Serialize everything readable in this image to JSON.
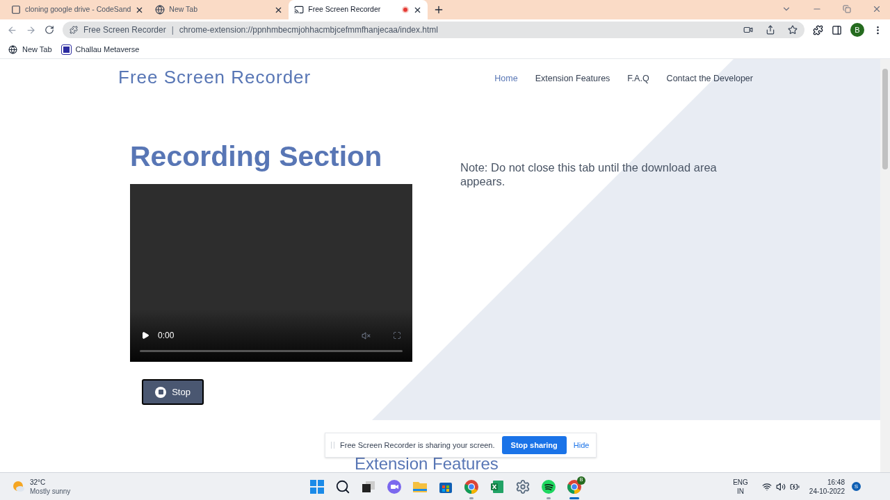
{
  "browser": {
    "tabs": [
      {
        "title": "cloning google drive - CodeSand",
        "selected": false,
        "kind": "square",
        "recording": false
      },
      {
        "title": "New Tab",
        "selected": false,
        "kind": "chrome",
        "recording": false
      },
      {
        "title": "Free Screen Recorder",
        "selected": true,
        "kind": "cast",
        "recording": true
      }
    ],
    "address": {
      "site": "Free Screen Recorder",
      "separator": "|",
      "url": "chrome-extension://ppnhmbecmjohhacmbjcefmmfhanjecaa/index.html"
    },
    "profile": "B",
    "bookmarks": [
      {
        "label": "New Tab",
        "kind": "globe"
      },
      {
        "label": "Challau Metaverse",
        "kind": "logo"
      }
    ]
  },
  "page": {
    "brand": "Free Screen Recorder",
    "nav": [
      {
        "label": "Home",
        "selected": true
      },
      {
        "label": "Extension Features",
        "selected": false
      },
      {
        "label": "F.A.Q",
        "selected": false
      },
      {
        "label": "Contact the Developer",
        "selected": false
      }
    ],
    "heading": "Recording Section",
    "note": "Note: Do not close this tab until the download area appears.",
    "video": {
      "time": "0:00"
    },
    "stop_button": "Stop",
    "next_heading": "Extension Features"
  },
  "share_bar": {
    "message": "Free Screen Recorder is sharing your screen.",
    "stop": "Stop sharing",
    "hide": "Hide"
  },
  "taskbar": {
    "weather": {
      "temp": "32°C",
      "condition": "Mostly sunny"
    },
    "apps": [
      {
        "kind": "start",
        "running": false,
        "active": false
      },
      {
        "kind": "search",
        "running": false,
        "active": false
      },
      {
        "kind": "taskview",
        "running": false,
        "active": false
      },
      {
        "kind": "chat",
        "running": false,
        "active": false
      },
      {
        "kind": "files",
        "running": false,
        "active": false
      },
      {
        "kind": "store",
        "running": false,
        "active": false
      },
      {
        "kind": "chrome",
        "running": true,
        "active": false
      },
      {
        "kind": "excel",
        "running": false,
        "active": false
      },
      {
        "kind": "settings",
        "running": false,
        "active": false
      },
      {
        "kind": "spotify",
        "running": true,
        "active": false
      },
      {
        "kind": "chrome-profile",
        "running": true,
        "active": true,
        "badge": "B"
      }
    ],
    "lang": "ENG",
    "region": "IN",
    "time": "16:48",
    "date": "24-10-2022",
    "user": "S"
  }
}
